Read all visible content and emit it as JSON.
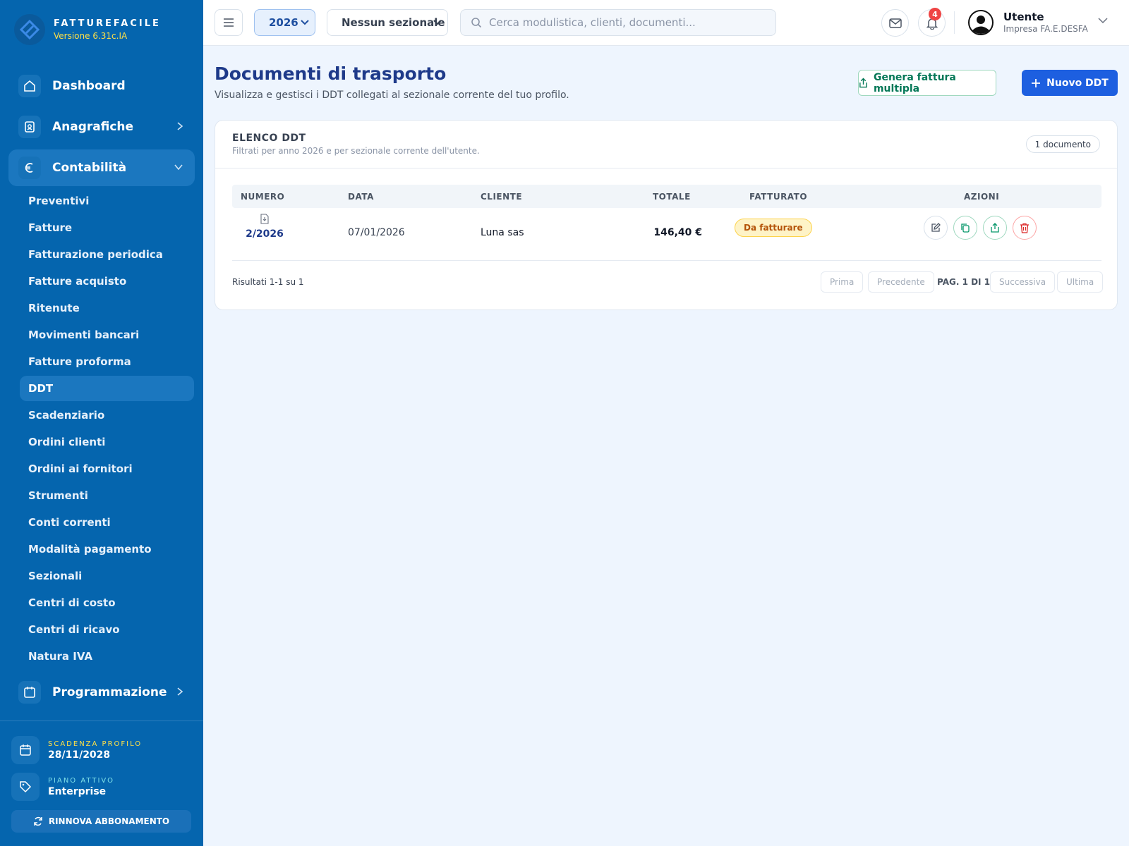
{
  "brand": {
    "name": "FATTUREFACILE",
    "version": "Versione 6.31c.IA"
  },
  "sidebar": {
    "dashboard": "Dashboard",
    "anagrafiche": "Anagrafiche",
    "contabilita": "Contabilità",
    "programmazione": "Programmazione",
    "items": [
      "Preventivi",
      "Fatture",
      "Fatturazione periodica",
      "Fatture acquisto",
      "Ritenute",
      "Movimenti bancari",
      "Fatture proforma",
      "DDT",
      "Scadenziario",
      "Ordini clienti",
      "Ordini ai fornitori",
      "Strumenti",
      "Conti correnti",
      "Modalità pagamento",
      "Sezionali",
      "Centri di costo",
      "Centri di ricavo",
      "Natura IVA"
    ],
    "active_item": "DDT",
    "profile_expiry_label": "SCADENZA PROFILO",
    "profile_expiry_value": "28/11/2028",
    "plan_label": "PIANO ATTIVO",
    "plan_value": "Enterprise",
    "renew_label": "RINNOVA ABBONAMENTO"
  },
  "topbar": {
    "year": "2026",
    "sezionale": "Nessun sezionale",
    "search_placeholder": "Cerca modulistica, clienti, documenti...",
    "notifications_count": "4",
    "user_name": "Utente",
    "user_company": "Impresa FA.E.DESFA"
  },
  "page": {
    "title": "Documenti di trasporto",
    "subtitle": "Visualizza e gestisci i DDT collegati al sezionale corrente del tuo profilo.",
    "btn_multi_invoice": "Genera fattura multipla",
    "btn_new": "Nuovo DDT"
  },
  "card": {
    "title": "ELENCO DDT",
    "subtitle": "Filtrati per anno 2026 e per sezionale corrente dell'utente.",
    "count": "1 documento"
  },
  "table": {
    "headers": {
      "numero": "NUMERO",
      "data": "DATA",
      "cliente": "CLIENTE",
      "totale": "TOTALE",
      "fatturato": "FATTURATO",
      "azioni": "AZIONI"
    },
    "rows": [
      {
        "numero": "2/2026",
        "data": "07/01/2026",
        "cliente": "Luna sas",
        "totale": "146,40 €",
        "fatturato": "Da fatturare"
      }
    ]
  },
  "pagination": {
    "results": "Risultati 1-1 su 1",
    "first": "Prima",
    "prev": "Precedente",
    "info": "PAG. 1 DI 1",
    "next": "Successiva",
    "last": "Ultima"
  },
  "colors": {
    "sidebar": "#0565ae",
    "primary": "#1d5fe0",
    "accent_yellow": "#fde047",
    "badge_warning": "#b45309"
  }
}
